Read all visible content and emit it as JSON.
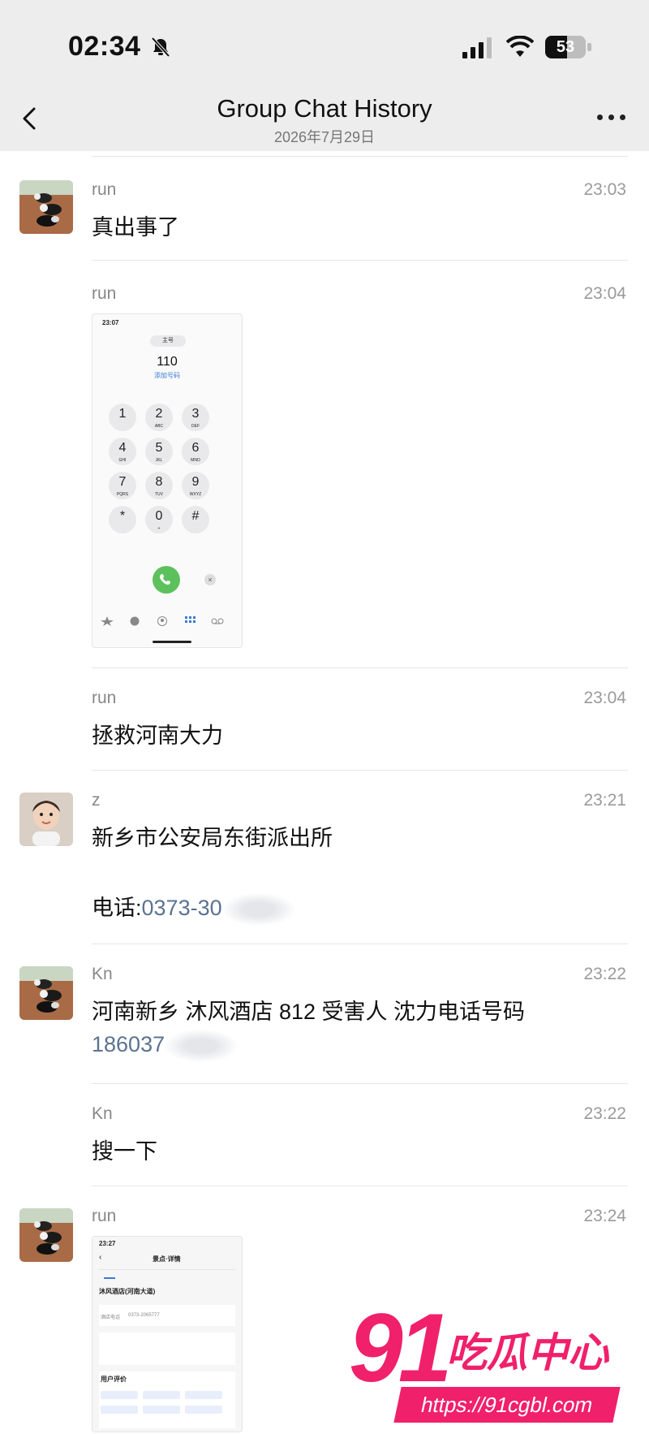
{
  "status_bar": {
    "time": "02:34",
    "battery": "53",
    "battery_level": 0.53
  },
  "nav": {
    "title": "Group Chat History",
    "subtitle": "2026年7月29日"
  },
  "messages": [
    {
      "sender": "run",
      "time": "23:03",
      "text": "真出事了"
    },
    {
      "sender": "run",
      "time": "23:04",
      "type": "image"
    },
    {
      "sender": "run",
      "time": "23:04",
      "text": "拯救河南大力"
    },
    {
      "sender": "z",
      "time": "23:21",
      "line1": "新乡市公安局东街派出所",
      "phone_label": "电话:",
      "phone_value": "0373-30"
    },
    {
      "sender": "Kn",
      "time": "23:22",
      "line1": "河南新乡 沐风酒店 812 受害人 沈力电话号码",
      "phone_value": "186037"
    },
    {
      "sender": "Kn",
      "time": "23:22",
      "text": "搜一下"
    },
    {
      "sender": "run",
      "time": "23:24",
      "type": "image"
    }
  ],
  "dialer": {
    "status_time": "23:07",
    "pill": "主号",
    "number": "110",
    "add_number": "添加号码",
    "keys": [
      {
        "d": "1",
        "l": ""
      },
      {
        "d": "2",
        "l": "ABC"
      },
      {
        "d": "3",
        "l": "DEF"
      },
      {
        "d": "4",
        "l": "GHI"
      },
      {
        "d": "5",
        "l": "JKL"
      },
      {
        "d": "6",
        "l": "MNO"
      },
      {
        "d": "7",
        "l": "PQRS"
      },
      {
        "d": "8",
        "l": "TUV"
      },
      {
        "d": "9",
        "l": "WXYZ"
      },
      {
        "d": "*",
        "l": ""
      },
      {
        "d": "0",
        "l": "+"
      },
      {
        "d": "#",
        "l": ""
      }
    ]
  },
  "hotel_shot": {
    "status_time": "23:27",
    "title": "景点·详情",
    "hotel_name": "沐风酒店(河南大道)",
    "phone_label": "酒店电话",
    "phone": "0373-2065777",
    "reviews_label": "用户评价"
  },
  "watermark": {
    "brand": "91",
    "name": "吃瓜中心",
    "url": "https://91cgbl.com"
  }
}
